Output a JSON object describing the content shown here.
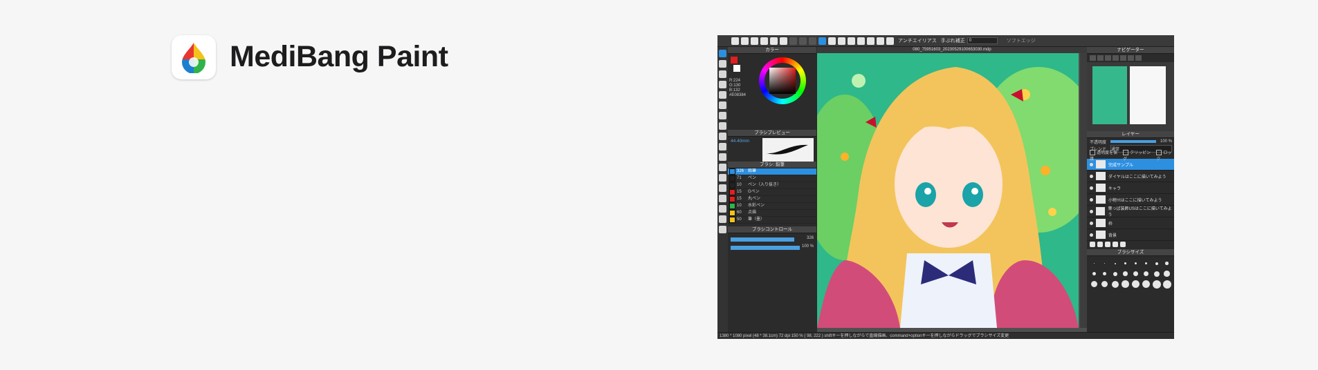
{
  "header": {
    "brand_name": "MediBang Paint",
    "logo_icon": "medibang-drop-logo",
    "brand_colors": [
      "#e8362f",
      "#f4c21a",
      "#2fb34a",
      "#1e7fd0"
    ]
  },
  "screenshot": {
    "toolbar": {
      "antialias_label": "アンチエイリアス",
      "correction_label": "手ぶれ補正",
      "correction_value": "0",
      "soft_edge_label": "ソフトエッジ"
    },
    "canvas_tab": "080_75951603_20230529100653030.mdp",
    "color_panel": {
      "title": "カラー",
      "rgb_r": "R:224",
      "rgb_g": "G:130",
      "rgb_b": "B:132",
      "hex": "#E08384",
      "primary_color": "#e02020",
      "secondary_color": "#ffffff"
    },
    "brush_preview": {
      "title": "ブラシプレビュー",
      "size_label": "44.40mm"
    },
    "brush_panel": {
      "title": "ブラシ: 鉛筆",
      "items": [
        {
          "num": "326",
          "name": "鉛筆",
          "color": "#2d8fe0",
          "selected": true
        },
        {
          "num": "71",
          "name": "ペン",
          "color": "#222222"
        },
        {
          "num": "10",
          "name": "ペン（入り抜き）",
          "color": "#222222"
        },
        {
          "num": "15",
          "name": "Gペン",
          "color": "#e02020"
        },
        {
          "num": "15",
          "name": "丸ペン",
          "color": "#e02020"
        },
        {
          "num": "10",
          "name": "水彩ペン",
          "color": "#2fb34a"
        },
        {
          "num": "60",
          "name": "点描",
          "color": "#f4c21a"
        },
        {
          "num": "50",
          "name": "筆（墨）",
          "color": "#f4c21a"
        }
      ]
    },
    "brush_control": {
      "title": "ブラシコントロール",
      "size_value": "326",
      "opacity_value": "100 %",
      "size_fraction": 0.92,
      "opacity_fraction": 1.0
    },
    "navigator": {
      "title": "ナビゲーター"
    },
    "layer_panel": {
      "title": "レイヤー",
      "opacity_label": "不透明度",
      "opacity_value": "100 %",
      "blend_label": "ブレンド",
      "blend_value": "通常",
      "protect_alpha": "透明度を保護",
      "clipping": "クリッピング",
      "lock": "ロック",
      "layers": [
        {
          "name": "完成サンプル",
          "selected": true
        },
        {
          "name": "ダイヤルはここに描いてみよう"
        },
        {
          "name": "キャラ"
        },
        {
          "name": "小物Ytはここに描いてみよう"
        },
        {
          "name": "葉っぱ装飾USはここに描いてみよう"
        },
        {
          "name": "枠"
        },
        {
          "name": "背景"
        }
      ]
    },
    "brush_size_panel": {
      "title": "ブラシサイズ",
      "sizes": [
        "0.7",
        "1",
        "1.5",
        "2",
        "3",
        "4",
        "5",
        "6",
        "7",
        "8",
        "10",
        "12",
        "15",
        "20",
        "25",
        "30",
        "40",
        "50",
        "60",
        "70",
        "80",
        "100",
        "120",
        "150"
      ]
    },
    "status_bar": "1380 * 1080 pixel  (48 * 38.1cm)  72 dpi  150 %  ( 98, 222 )  shiftキーを押しながらで直線描画、command+optionキーを押しながらドラッグでブラシサイズ変更"
  }
}
